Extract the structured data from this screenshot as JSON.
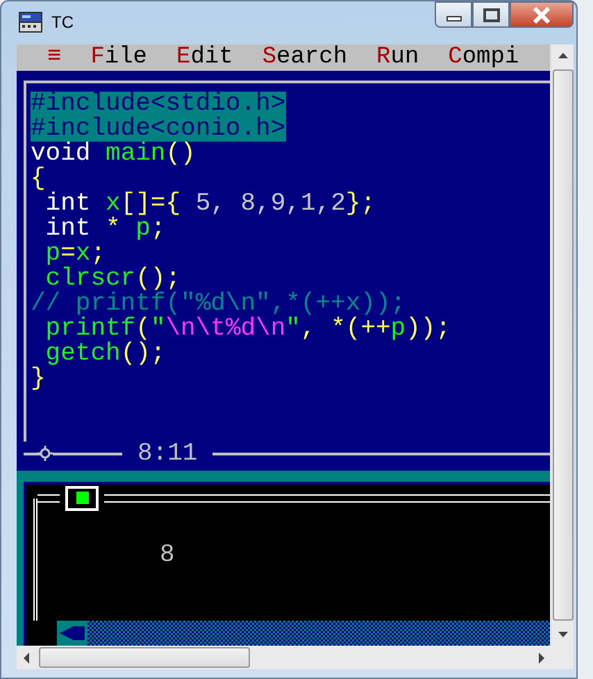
{
  "window": {
    "title": "TC"
  },
  "menu": {
    "system": "≡",
    "items": [
      {
        "label": "File"
      },
      {
        "label": "Edit"
      },
      {
        "label": "Search"
      },
      {
        "label": "Run"
      },
      {
        "label": "Compi"
      }
    ]
  },
  "editor": {
    "lines": [
      {
        "highlighted": true,
        "tokens": [
          {
            "kind": "preproc",
            "text": "#include<stdio.h>"
          }
        ]
      },
      {
        "highlighted": true,
        "tokens": [
          {
            "kind": "preproc",
            "text": "#include<conio.h>"
          }
        ]
      },
      {
        "highlighted": false,
        "tokens": [
          {
            "kind": "keyword",
            "text": "void "
          },
          {
            "kind": "ident",
            "text": "main"
          },
          {
            "kind": "symbol",
            "text": "()"
          }
        ]
      },
      {
        "highlighted": false,
        "tokens": [
          {
            "kind": "symbol",
            "text": "{"
          }
        ]
      },
      {
        "highlighted": false,
        "tokens": [
          {
            "kind": "keyword",
            "text": " int "
          },
          {
            "kind": "ident",
            "text": "x"
          },
          {
            "kind": "symbol",
            "text": "[]={"
          },
          {
            "kind": "number",
            "text": " 5, 8,9,1,2"
          },
          {
            "kind": "symbol",
            "text": "};"
          }
        ]
      },
      {
        "highlighted": false,
        "tokens": [
          {
            "kind": "keyword",
            "text": " int "
          },
          {
            "kind": "symbol",
            "text": "* "
          },
          {
            "kind": "ident",
            "text": "p"
          },
          {
            "kind": "symbol",
            "text": ";"
          }
        ]
      },
      {
        "highlighted": false,
        "tokens": [
          {
            "kind": "ident",
            "text": " p"
          },
          {
            "kind": "symbol",
            "text": "="
          },
          {
            "kind": "ident",
            "text": "x"
          },
          {
            "kind": "symbol",
            "text": ";"
          }
        ]
      },
      {
        "highlighted": false,
        "tokens": [
          {
            "kind": "ident",
            "text": " clrscr"
          },
          {
            "kind": "symbol",
            "text": "();"
          }
        ]
      },
      {
        "highlighted": false,
        "tokens": [
          {
            "kind": "comment",
            "text": "// printf(\"%d\\n\",*(++x));"
          }
        ]
      },
      {
        "highlighted": false,
        "tokens": [
          {
            "kind": "ident",
            "text": " printf"
          },
          {
            "kind": "symbol",
            "text": "("
          },
          {
            "kind": "ident",
            "text": "\""
          },
          {
            "kind": "string",
            "text": "\\n\\t%d\\n"
          },
          {
            "kind": "ident",
            "text": "\""
          },
          {
            "kind": "symbol",
            "text": ", *(++"
          },
          {
            "kind": "ident",
            "text": "p"
          },
          {
            "kind": "symbol",
            "text": "));"
          }
        ]
      },
      {
        "highlighted": false,
        "tokens": [
          {
            "kind": "ident",
            "text": " getch"
          },
          {
            "kind": "symbol",
            "text": "();"
          }
        ]
      },
      {
        "highlighted": false,
        "tokens": [
          {
            "kind": "symbol",
            "text": "}"
          }
        ]
      }
    ],
    "status": {
      "position": "8:11"
    }
  },
  "output": {
    "lines": [
      "8"
    ]
  }
}
